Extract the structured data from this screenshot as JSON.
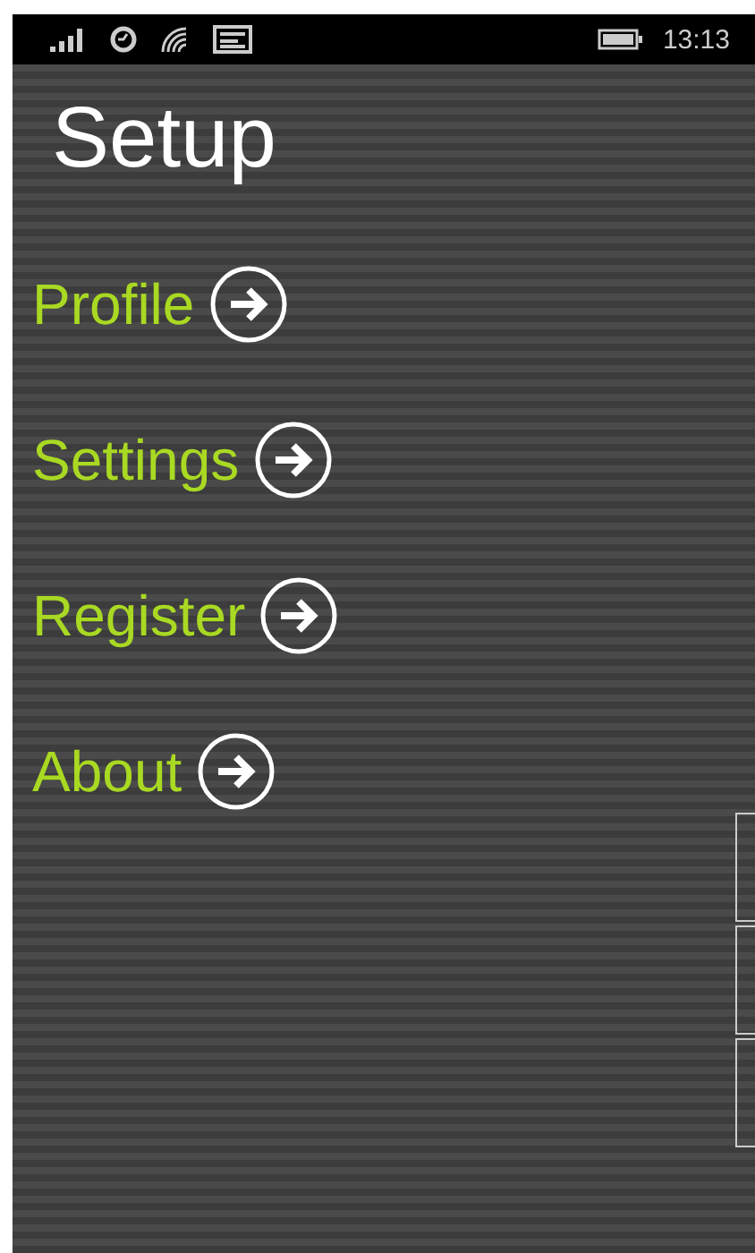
{
  "status_bar": {
    "time": "13:13"
  },
  "title": "Setup",
  "menu": [
    {
      "label": "Profile"
    },
    {
      "label": "Settings"
    },
    {
      "label": "Register"
    },
    {
      "label": "About"
    }
  ]
}
